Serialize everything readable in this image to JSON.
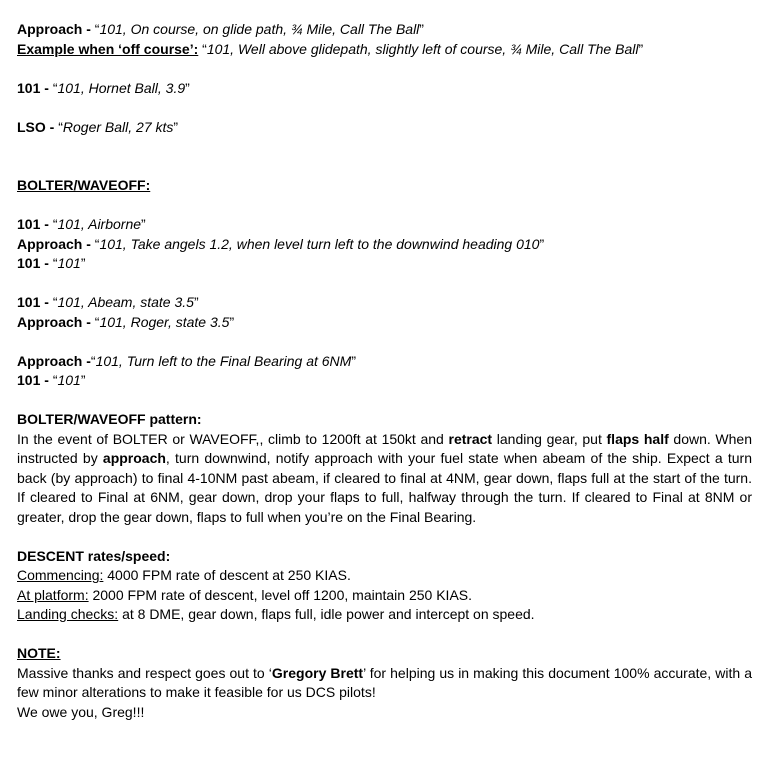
{
  "doc": {
    "line1": {
      "label": "Approach - ",
      "q1": "“",
      "quote": "101, On course, on glide path, ¾ Mile, Call The Ball",
      "q2": "”"
    },
    "line2": {
      "label": "Example when ‘off course’:",
      "q1": " “",
      "quote": "101, Well above glidepath, slightly left of course, ¾ Mile, Call The Ball",
      "q2": "”"
    },
    "line3": {
      "label": "101 - ",
      "q1": "“",
      "quote": "101, Hornet Ball, 3.9",
      "q2": "”"
    },
    "line4": {
      "label": "LSO - ",
      "q1": "“",
      "quote": "Roger Ball, 27 kts",
      "q2": "”"
    },
    "bolter_heading": "BOLTER/WAVEOFF:",
    "line5": {
      "label": "101 - ",
      "q1": "“",
      "quote": "101, Airborne",
      "q2": "”"
    },
    "line6": {
      "label": "Approach - ",
      "q1": "“",
      "quote": "101, Take angels 1.2, when level turn left to the downwind heading 010",
      "q2": "”"
    },
    "line7": {
      "label": "101 - ",
      "q1": "“",
      "quote": "101",
      "q2": "”"
    },
    "line8": {
      "label": "101 - ",
      "q1": "“",
      "quote": "101, Abeam, state 3.5",
      "q2": "”"
    },
    "line9": {
      "label": "Approach - ",
      "q1": "“",
      "quote": "101, Roger, state 3.5",
      "q2": "”"
    },
    "line10": {
      "label": "Approach -",
      "q1": "“",
      "quote": "101, Turn left to the Final Bearing at 6NM",
      "q2": "”"
    },
    "line11": {
      "label": "101 - ",
      "q1": "“",
      "quote": "101",
      "q2": "”"
    },
    "pattern": {
      "heading": "BOLTER/WAVEOFF pattern:",
      "p1": "In the event of BOLTER or WAVEOFF,, climb to 1200ft at 150kt and ",
      "b1": "retract",
      "p2": " landing gear, put ",
      "b2": "flaps half",
      "p3": " down. When instructed by ",
      "b3": "approach",
      "p4": ", turn downwind, notify approach with your fuel state when abeam of the ship. Expect a turn back (by approach) to final 4-10NM past abeam, if cleared to final at 4NM, gear down, flaps full at the start of the turn. If cleared to Final at 6NM, gear down, drop your flaps to full, halfway through the turn. If cleared to Final at 8NM or greater, drop the gear down, flaps to full when you’re on the Final Bearing."
    },
    "descent": {
      "heading": "DESCENT rates/speed:",
      "commencing_label": "Commencing:",
      "commencing_text": " 4000 FPM rate of descent at 250 KIAS.",
      "platform_label": "At platform:",
      "platform_text": " 2000 FPM rate of descent, level off 1200, maintain 250 KIAS.",
      "landing_label": "Landing checks:",
      "landing_text": " at 8 DME, gear down, flaps full, idle power and intercept on speed."
    },
    "note": {
      "heading": "NOTE:",
      "p1": "Massive thanks and respect goes out to ‘",
      "name": "Gregory Brett",
      "p2": "’ for helping us in making this document 100% accurate, with a few minor alterations to make it feasible for us DCS pilots!",
      "closing": "We owe you, Greg!!!"
    }
  }
}
